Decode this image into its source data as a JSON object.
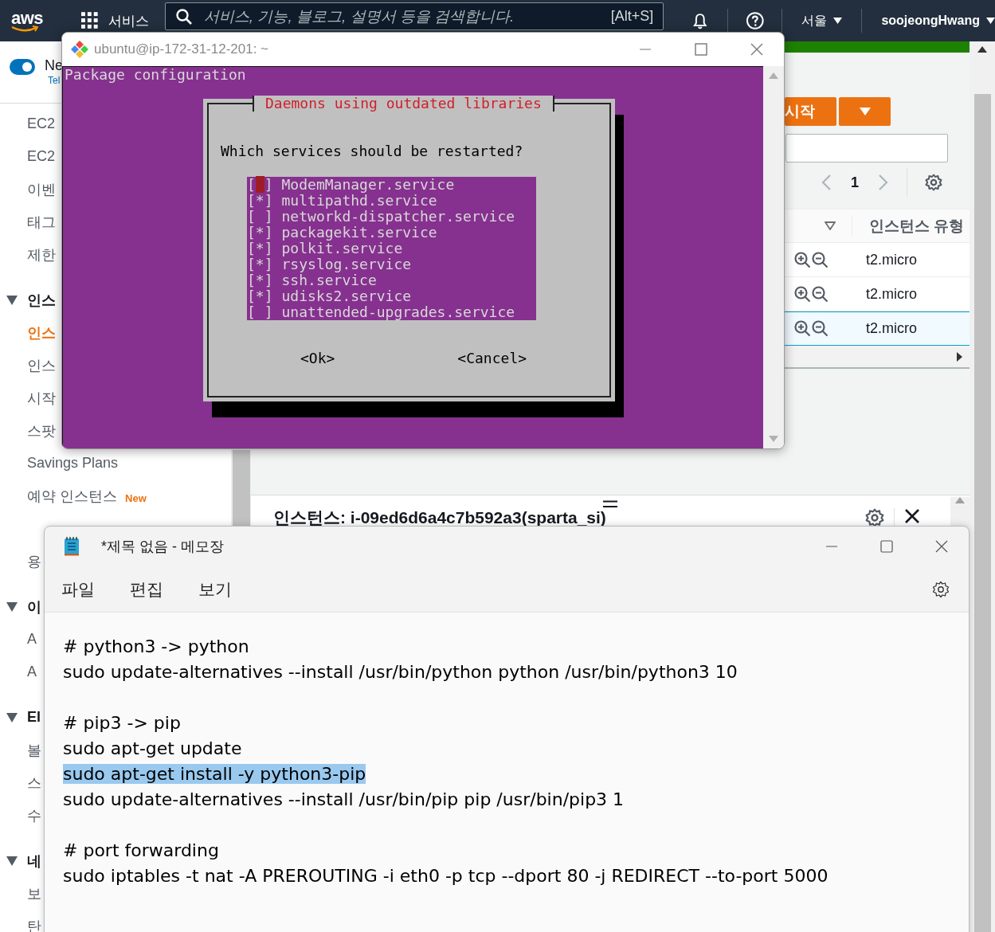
{
  "topbar": {
    "logo": "aws",
    "services": "서비스",
    "search": {
      "placeholder": "서비스, 기능, 블로그, 설명서 등을 검색합니다.",
      "shortcut": "[Alt+S]"
    },
    "region": "서울",
    "user": "soojeongHwang"
  },
  "sidebar": {
    "toggle": {
      "label": "Ne",
      "sublabel": "Tel",
      "on": true
    },
    "items": [
      {
        "kind": "link",
        "label": "EC2",
        "selected": false
      },
      {
        "kind": "link",
        "label": "EC2",
        "selected": false
      },
      {
        "kind": "link",
        "label": "이벤",
        "selected": false
      },
      {
        "kind": "link",
        "label": "태그",
        "selected": false
      },
      {
        "kind": "link",
        "label": "제한",
        "selected": false
      },
      {
        "kind": "section",
        "label": "인스",
        "expanded": true
      },
      {
        "kind": "link",
        "label": "인스",
        "selected": true
      },
      {
        "kind": "link",
        "label": "인스",
        "selected": false
      },
      {
        "kind": "link",
        "label": "시작",
        "selected": false
      },
      {
        "kind": "link",
        "label": "스팟",
        "selected": false
      },
      {
        "kind": "link",
        "label": "Savings Plans",
        "selected": false
      },
      {
        "kind": "link",
        "label": "예약 인스턴스",
        "badge": "New",
        "selected": false
      },
      {
        "kind": "link",
        "label": "용",
        "selected": false
      },
      {
        "kind": "section",
        "label": "이",
        "expanded": true
      },
      {
        "kind": "link",
        "label": "A",
        "selected": false
      },
      {
        "kind": "link",
        "label": "A",
        "selected": false
      },
      {
        "kind": "section",
        "label": "El",
        "expanded": true
      },
      {
        "kind": "link",
        "label": "볼",
        "selected": false
      },
      {
        "kind": "link",
        "label": "스",
        "selected": false
      },
      {
        "kind": "link",
        "label": "수",
        "selected": false
      },
      {
        "kind": "section",
        "label": "네",
        "expanded": true
      },
      {
        "kind": "link",
        "label": "보",
        "selected": false
      },
      {
        "kind": "link",
        "label": "탄",
        "selected": false
      }
    ]
  },
  "content": {
    "launch_button": "시작",
    "pagination": {
      "page": "1"
    },
    "table": {
      "column": "인스턴스 유형",
      "rows": [
        {
          "type": "t2.micro",
          "selected": false
        },
        {
          "type": "t2.micro",
          "selected": false
        },
        {
          "type": "t2.micro",
          "selected": true
        }
      ]
    }
  },
  "detail_panel": {
    "title": "인스턴스: i-09ed6d6a4c7b592a3(sparta_si)"
  },
  "terminal": {
    "title": "ubuntu@ip-172-31-12-201: ~",
    "header": "Package configuration",
    "dialog": {
      "title": "Daemons using outdated libraries",
      "question": "Which services should be restarted?",
      "box_open": "[",
      "box_close": "]",
      "check_mark": "*",
      "services": [
        {
          "name": "ModemManager.service",
          "checked": false,
          "focused": true
        },
        {
          "name": "multipathd.service",
          "checked": true,
          "focused": false
        },
        {
          "name": "networkd-dispatcher.service",
          "checked": false,
          "focused": false
        },
        {
          "name": "packagekit.service",
          "checked": true,
          "focused": false
        },
        {
          "name": "polkit.service",
          "checked": true,
          "focused": false
        },
        {
          "name": "rsyslog.service",
          "checked": true,
          "focused": false
        },
        {
          "name": "ssh.service",
          "checked": true,
          "focused": false
        },
        {
          "name": "udisks2.service",
          "checked": true,
          "focused": false
        },
        {
          "name": "unattended-upgrades.service",
          "checked": false,
          "focused": false
        }
      ],
      "buttons": [
        "<Ok>",
        "<Cancel>"
      ]
    }
  },
  "notepad": {
    "title": "*제목 없음 - 메모장",
    "menu": [
      "파일",
      "편집",
      "보기"
    ],
    "paragraphs": [
      [
        {
          "text": "# python3 -> python",
          "selected": false
        },
        {
          "text": "sudo update-alternatives --install /usr/bin/python python /usr/bin/python3 10",
          "selected": false
        }
      ],
      [
        {
          "text": "# pip3 -> pip",
          "selected": false
        },
        {
          "text": "sudo apt-get update",
          "selected": false
        },
        {
          "text": "sudo apt-get install -y python3-pip",
          "selected": true
        },
        {
          "text": "sudo update-alternatives --install /usr/bin/pip pip /usr/bin/pip3 1",
          "selected": false
        }
      ],
      [
        {
          "text": "# port forwarding",
          "selected": false
        },
        {
          "text": "sudo iptables -t nat -A PREROUTING -i eth0 -p tcp --dport 80 -j REDIRECT --to-port 5000",
          "selected": false
        }
      ]
    ]
  }
}
